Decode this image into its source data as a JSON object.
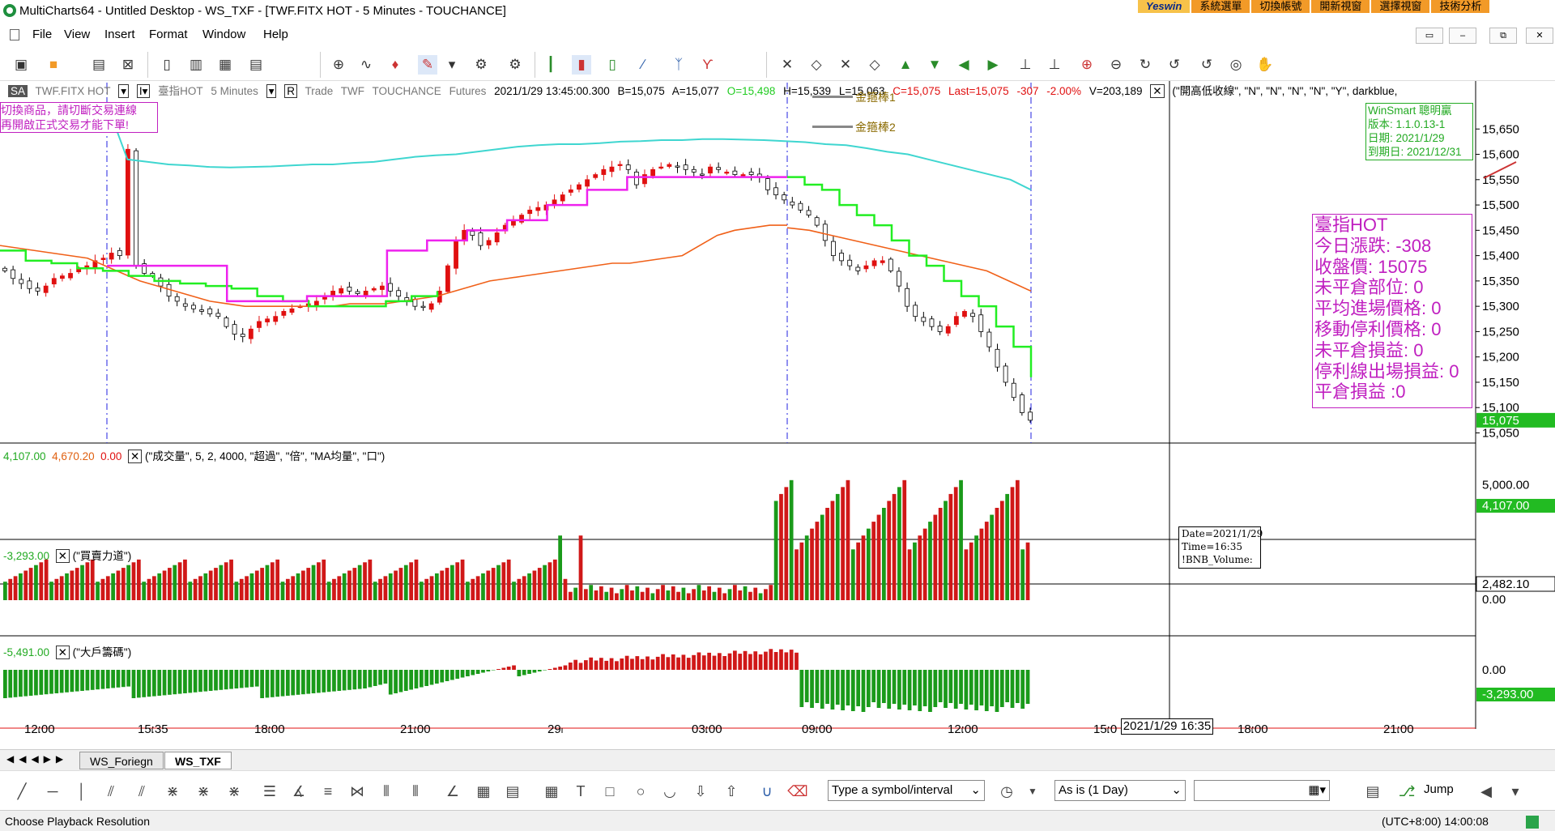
{
  "window": {
    "title": "MultiCharts64 - Untitled Desktop - WS_TXF - [TWF.FITX HOT - 5 Minutes - TOUCHANCE]",
    "brand_menu": [
      "Yeswin",
      "系統選單",
      "切換帳號",
      "開新視窗",
      "選擇視窗",
      "技術分析"
    ],
    "controls": [
      "▭",
      "–",
      "⧉",
      "✕"
    ]
  },
  "menu": [
    "File",
    "View",
    "Insert",
    "Format",
    "Window",
    "Help"
  ],
  "status_line": {
    "mode": "SA",
    "symbol": "TWF.FITX HOT",
    "alias": "臺指HOT",
    "interval": "5 Minutes",
    "chart_type": "R",
    "trade": "Trade",
    "exchange": "TWF",
    "source": "TOUCHANCE",
    "category": "Futures",
    "datetime": "2021/1/29  13:45:00.300",
    "bid": "B=15,075",
    "ask": "A=15,077",
    "open": "O=15,498",
    "high": "H=15,539",
    "low": "L=15,063",
    "close": "C=15,075",
    "last": "Last=15,075",
    "change": "-307",
    "change_pct": "-2.00%",
    "volume": "V=203,189",
    "study": "(\"開高低收線\", \"N\", \"N\", \"N\", \"N\", \"Y\", darkblue,"
  },
  "legend": {
    "line1": "金箍棒1",
    "line2": "金箍棒2"
  },
  "warning": [
    "切換商品，請切斷交易連線",
    "再開啟正式交易才能下單!"
  ],
  "version_box": [
    "WinSmart 聰明贏",
    "版本: 1.1.0.13-1",
    "日期: 2021/1/29",
    "到期日: 2021/12/31"
  ],
  "info_box": [
    "臺指HOT",
    "今日漲跌: -308",
    "收盤價: 15075",
    "未平倉部位: 0",
    "平均進場價格: 0",
    "移動停利價格: 0",
    "未平倉損益: 0",
    "停利線出場損益: 0",
    "平倉損益 :0"
  ],
  "price_axis": {
    "ticks": [
      "15,650",
      "15,600",
      "15,550",
      "15,500",
      "15,450",
      "15,400",
      "15,350",
      "15,300",
      "15,250",
      "15,200",
      "15,150",
      "15,100",
      "15,050"
    ],
    "last_label": "15,075"
  },
  "volume_pane": {
    "label_values": [
      "4,107.00",
      "4,670.20",
      "0.00"
    ],
    "study": "(\"成交量\", 5, 2, 4000, \"超過\", \"倍\", \"MA均量\", \"口\")",
    "ticks": [
      "5,000.00",
      "0.00"
    ],
    "last_label": "4,107.00",
    "cursor_label": "2,482.10"
  },
  "power_pane": {
    "label_value": "-3,293.00",
    "study": "(\"買賣力道\")",
    "tick": "0.00",
    "last_label": "-3,293.00"
  },
  "chips_pane": {
    "label_value": "-5,491.00",
    "study": "(\"大戶籌碼\")",
    "tick": "0.00",
    "last_label": "-5,491.00"
  },
  "tooltip": [
    "Date=2021/1/29",
    "Time=16:35",
    "!BNB_Volume:"
  ],
  "time_axis": {
    "labels": [
      "12:00",
      "15:35",
      "18:00",
      "21:00",
      "29",
      "03:00",
      "09:00",
      "12:00",
      "15:0",
      "18:00",
      "21:00"
    ],
    "cursor_label": "2021/1/29 16:35"
  },
  "sheets": [
    "WS_Foriegn",
    "WS_TXF"
  ],
  "draw_toolbar": {
    "symbol_placeholder": "Type a symbol/interval",
    "resolution": "As is (1 Day)",
    "jump_label": "Jump"
  },
  "statusbar": {
    "left": "Choose Playback Resolution",
    "right": "(UTC+8:00) 14:00:08"
  },
  "chart_data": {
    "type": "candlestick",
    "interval": "5 Minutes",
    "price_range": [
      15030,
      15700
    ],
    "close_series": [
      15370,
      15355,
      15345,
      15335,
      15330,
      15340,
      15355,
      15360,
      15365,
      15375,
      15380,
      15390,
      15395,
      15405,
      15400,
      15610,
      15380,
      15365,
      15360,
      15340,
      15320,
      15310,
      15300,
      15295,
      15290,
      15285,
      15280,
      15260,
      15245,
      15240,
      15255,
      15270,
      15275,
      15280,
      15290,
      15295,
      15300,
      15305,
      15310,
      15320,
      15330,
      15335,
      15330,
      15325,
      15330,
      15335,
      15340,
      15330,
      15320,
      15310,
      15300,
      15298,
      15305,
      15330,
      15380,
      15430,
      15450,
      15440,
      15420,
      15430,
      15445,
      15460,
      15470,
      15480,
      15490,
      15495,
      15500,
      15510,
      15520,
      15530,
      15540,
      15550,
      15560,
      15570,
      15575,
      15580,
      15570,
      15540,
      15560,
      15570,
      15575,
      15580,
      15575,
      15570,
      15565,
      15560,
      15575,
      15570,
      15565,
      15560,
      15560,
      15560,
      15555,
      15530,
      15520,
      15510,
      15500,
      15490,
      15480,
      15460,
      15430,
      15400,
      15390,
      15380,
      15370,
      15380,
      15390,
      15390,
      15370,
      15340,
      15300,
      15280,
      15270,
      15260,
      15250,
      15260,
      15280,
      15290,
      15280,
      15250,
      15220,
      15180,
      15150,
      15120,
      15090,
      15075
    ],
    "orange_ma": [
      15420,
      15415,
      15410,
      15405,
      15400,
      15395,
      15380,
      15365,
      15350,
      15340,
      15330,
      15320,
      15310,
      15305,
      15300,
      15300,
      15300,
      15300,
      15300,
      15300,
      15305,
      15305,
      15305,
      15310,
      15315,
      15320,
      15330,
      15340,
      15350,
      15355,
      15360,
      15365,
      15370,
      15375,
      15380,
      15385,
      15385,
      15390,
      15395,
      15400,
      15420,
      15440,
      15450,
      15455,
      15460,
      15460,
      15455,
      15450,
      15440,
      15430,
      15420,
      15410,
      15400,
      15390,
      15380,
      15370,
      15350,
      15330
    ],
    "cyan_line": [
      15700,
      15590,
      15585,
      15580,
      15578,
      15575,
      15574,
      15575,
      15576,
      15578,
      15580,
      15580,
      15583,
      15585,
      15590,
      15595,
      15598,
      15600,
      15605,
      15610,
      15615,
      15618,
      15620,
      15620,
      15622,
      15625,
      15626,
      15628,
      15628,
      15630,
      15630,
      15629,
      15628,
      15626,
      15624,
      15620,
      15618,
      15612,
      15605,
      15600,
      15590,
      15580,
      15570,
      15560,
      15550,
      15530
    ],
    "stop_line_green": [
      15410,
      15390,
      15385,
      15375,
      15370,
      15360,
      15350,
      15345,
      15340,
      15335,
      15320,
      15310,
      15300,
      15300,
      15300,
      15310,
      15320,
      15330,
      15555,
      15540,
      15530,
      15500,
      15480,
      15460,
      15430,
      15400,
      15380,
      15350,
      15320,
      15300,
      15260,
      15220,
      15160
    ],
    "stop_line_magenta": [
      15380,
      15380,
      15380,
      15310,
      15310,
      15320,
      15320,
      15410,
      15430,
      15450,
      15470,
      15500,
      15530,
      15555,
      15555,
      15555,
      15555,
      15555
    ],
    "volume_range": [
      0,
      6000
    ],
    "power_last": -3293,
    "chips_last": -5491
  }
}
